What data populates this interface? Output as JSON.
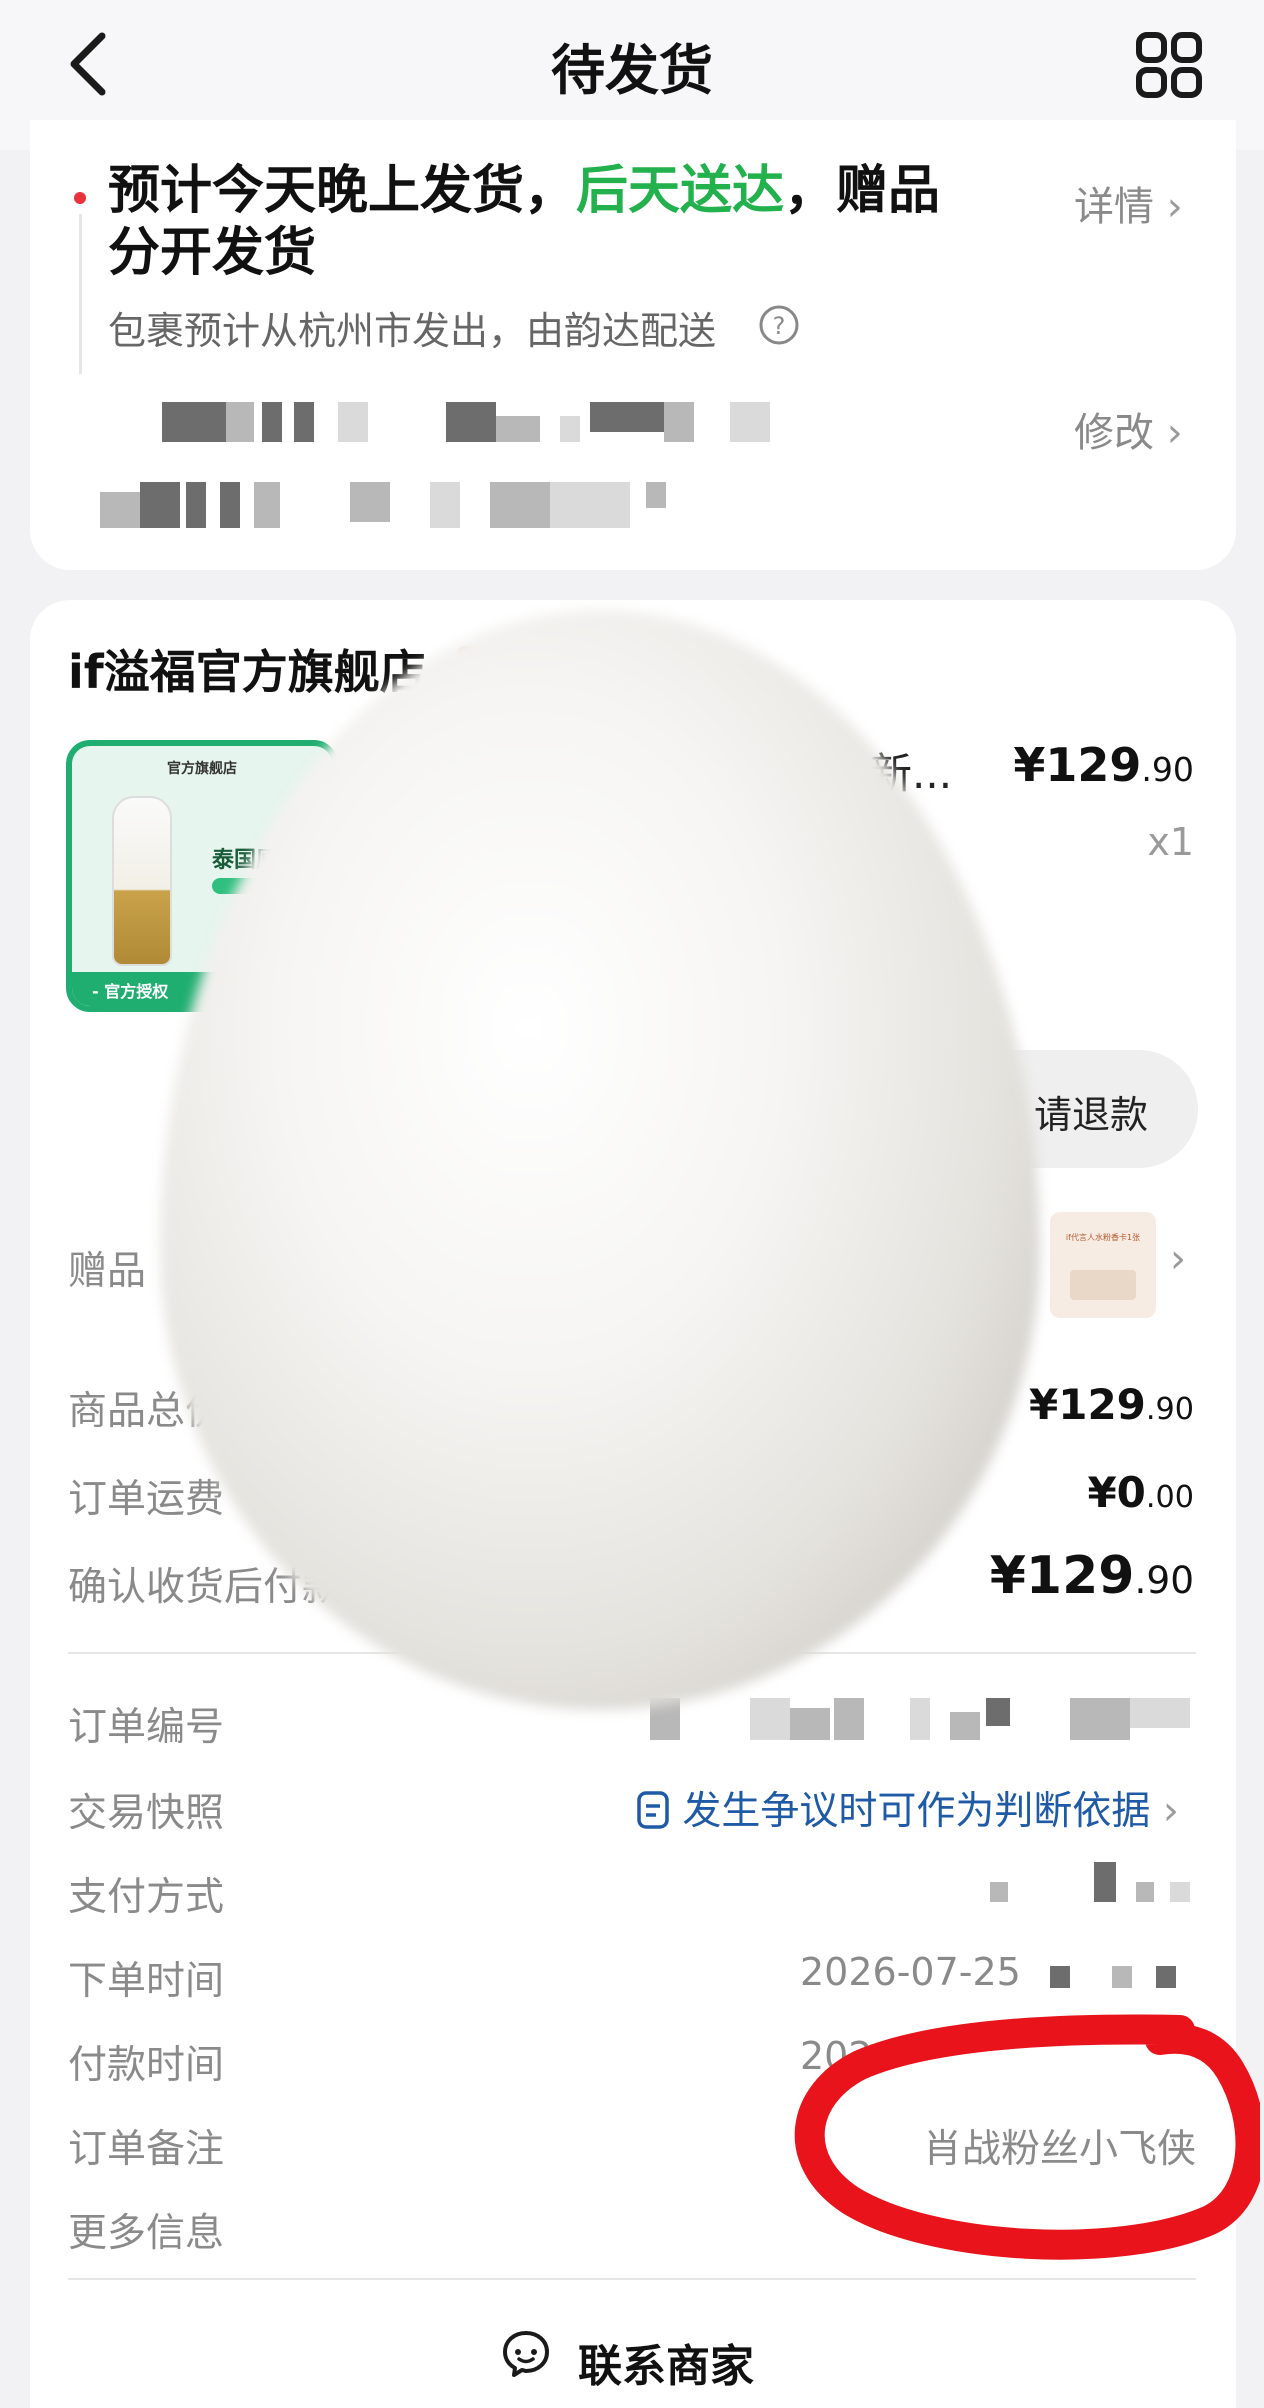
{
  "header": {
    "back_icon": "chevron-left-icon",
    "title": "待发货",
    "grid_icon": "grid-icon"
  },
  "shipping": {
    "line_part1": "预计今天晚上发货，",
    "line_highlight": "后天送达",
    "line_part2": "，赠品",
    "line_part3": "分开发货",
    "detail_link": "详情",
    "sub_text": "包裹预计从杭州市发出，由韵达配送",
    "help_icon": "question-circle-icon",
    "modify_link": "修改",
    "highlight_color": "#22b14c",
    "dot_color": "#e8323c"
  },
  "store": {
    "name": "if溢福官方旗舰店",
    "product": {
      "title_fragment": "新...",
      "price_main": "¥129",
      "price_decimal": ".90",
      "quantity": "x1",
      "refund_button": "请退款",
      "image_texts": {
        "top_label": "官方旗舰店",
        "headline": "泰国原装",
        "bottom_label": "- 官方授权"
      }
    },
    "gift_label": "赠品",
    "gift_image_text": "if代言人水粉香卡1张"
  },
  "summary": {
    "rows": [
      {
        "label": "商品总价",
        "price_main": "¥129",
        "price_decimal": ".90"
      },
      {
        "label": "订单运费",
        "price_main": "¥0",
        "price_decimal": ".00"
      },
      {
        "label": "确认收货后付款",
        "price_main": "¥129",
        "price_decimal": ".90"
      }
    ]
  },
  "order_info": {
    "order_number_label": "订单编号",
    "snapshot_label": "交易快照",
    "snapshot_link": "发生争议时可作为判断依据",
    "snapshot_icon": "document-icon",
    "payment_label": "支付方式",
    "order_time_label": "下单时间",
    "order_time_value": "2026-07-25",
    "pay_time_label": "付款时间",
    "pay_time_value": "202",
    "note_label": "订单备注",
    "note_value": "肖战粉丝小飞侠",
    "more_label": "更多信息"
  },
  "footer": {
    "contact_icon": "chat-bubble-icon",
    "contact_label": "联系商家"
  },
  "colors": {
    "link_blue": "#1f5aa6",
    "annotation_red": "#e8131b",
    "brand_green": "#1fae70"
  }
}
